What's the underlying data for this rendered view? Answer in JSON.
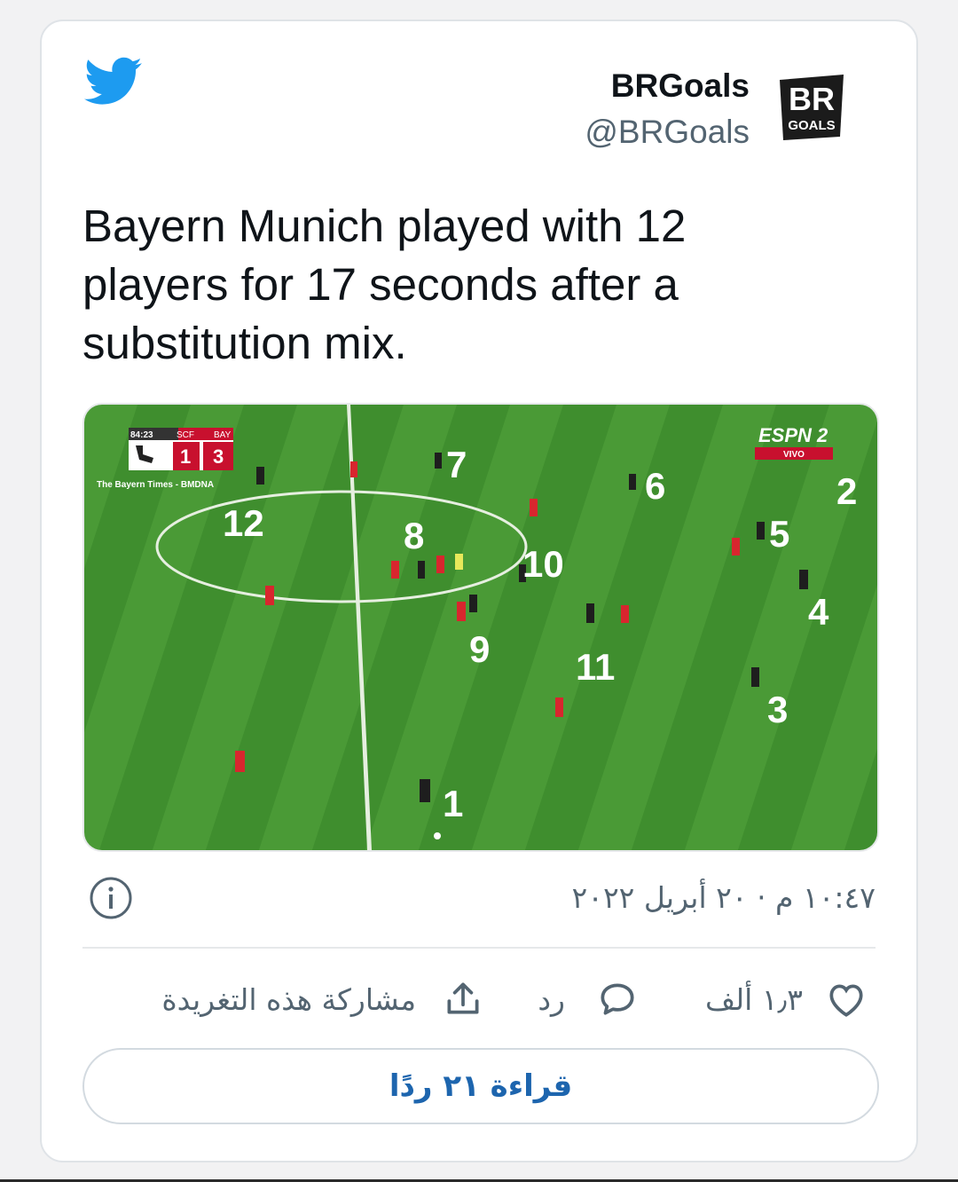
{
  "theme": {
    "accent": "#1d9bf0",
    "link": "#1d65ae",
    "text": "#0f1419",
    "muted": "#536471",
    "border": "#dfe3e7"
  },
  "header": {
    "icon": "twitter-bird-icon",
    "author_name": "BRGoals",
    "author_handle": "@BRGoals",
    "avatar_text_top": "BR",
    "avatar_text_bottom": "GOALS"
  },
  "tweet": {
    "text": "Bayern Munich played with 12 players for 17 seconds after a substitution mix."
  },
  "media": {
    "scoreboard": {
      "time": "84:23",
      "home": "SCF",
      "away": "BAY",
      "home_score": "1",
      "away_score": "3",
      "credit": "The Bayern Times - BMDNA"
    },
    "broadcaster": {
      "logo": "ESPN 2",
      "tag": "VIVO"
    },
    "player_numbers": [
      "1",
      "2",
      "3",
      "4",
      "5",
      "6",
      "7",
      "8",
      "9",
      "10",
      "11",
      "12"
    ]
  },
  "meta": {
    "info_icon": "info-icon",
    "timestamp": "١٠:٤٧ م · ٢٠ أبريل ٢٠٢٢"
  },
  "actions": {
    "like_count": "١٫٣ ألف",
    "reply_label": "رد",
    "share_label": "مشاركة هذه التغريدة"
  },
  "read_replies_label": "قراءة ٢١ ردًا"
}
